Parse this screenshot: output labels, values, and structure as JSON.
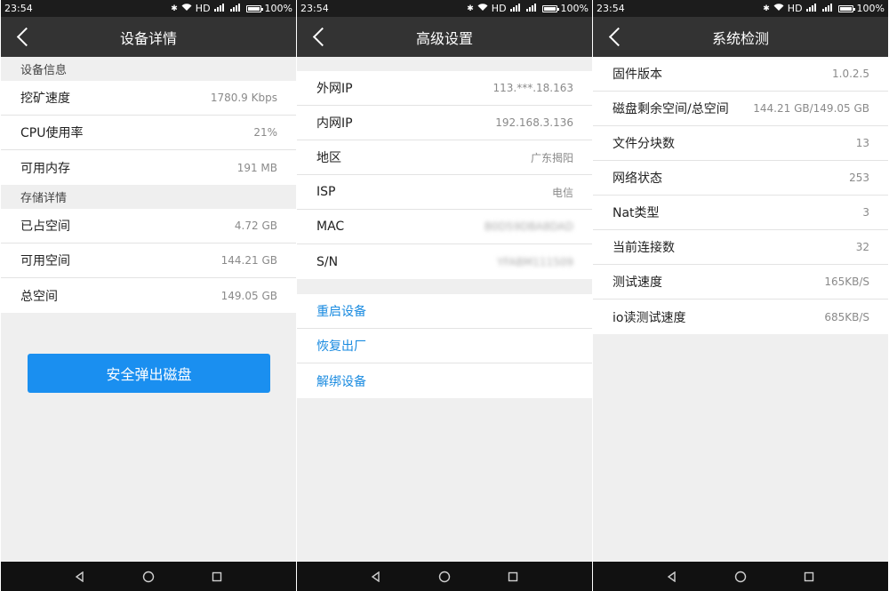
{
  "status_bar": {
    "time": "23:54",
    "signal_text": "HD",
    "battery": "100%"
  },
  "screens": [
    {
      "title": "设备详情",
      "sections": [
        {
          "header": "设备信息",
          "rows": [
            {
              "label": "挖矿速度",
              "value": "1780.9 Kbps"
            },
            {
              "label": "CPU使用率",
              "value": "21%"
            },
            {
              "label": "可用内存",
              "value": "191 MB"
            }
          ]
        },
        {
          "header": "存储详情",
          "rows": [
            {
              "label": "已占空间",
              "value": "4.72 GB"
            },
            {
              "label": "可用空间",
              "value": "144.21 GB"
            },
            {
              "label": "总空间",
              "value": "149.05 GB"
            }
          ]
        }
      ],
      "button_label": "安全弹出磁盘"
    },
    {
      "title": "高级设置",
      "rows": [
        {
          "label": "外网IP",
          "value": "113.***.18.163"
        },
        {
          "label": "内网IP",
          "value": "192.168.3.136"
        },
        {
          "label": "地区",
          "value": "广东揭阳"
        },
        {
          "label": "ISP",
          "value": "电信"
        },
        {
          "label": "MAC",
          "value": "B0D59DBA8DAD"
        },
        {
          "label": "S/N",
          "value": "YFABM111509"
        }
      ],
      "actions": [
        "重启设备",
        "恢复出厂",
        "解绑设备"
      ]
    },
    {
      "title": "系统检测",
      "rows": [
        {
          "label": "固件版本",
          "value": "1.0.2.5"
        },
        {
          "label": "磁盘剩余空间/总空间",
          "value": "144.21 GB/149.05 GB"
        },
        {
          "label": "文件分块数",
          "value": "13"
        },
        {
          "label": "网络状态",
          "value": "253"
        },
        {
          "label": "Nat类型",
          "value": "3"
        },
        {
          "label": "当前连接数",
          "value": "32"
        },
        {
          "label": "测试速度",
          "value": "165KB/S"
        },
        {
          "label": "io读测试速度",
          "value": "685KB/S"
        }
      ]
    }
  ],
  "colors": {
    "appbar": "#333333",
    "accent": "#1a8ff0",
    "link": "#1a8be0",
    "background": "#efefef"
  },
  "icons": [
    "back-arrow-icon",
    "wifi-icon",
    "signal-icon",
    "battery-icon",
    "nav-back-icon",
    "nav-home-icon",
    "nav-recent-icon"
  ]
}
